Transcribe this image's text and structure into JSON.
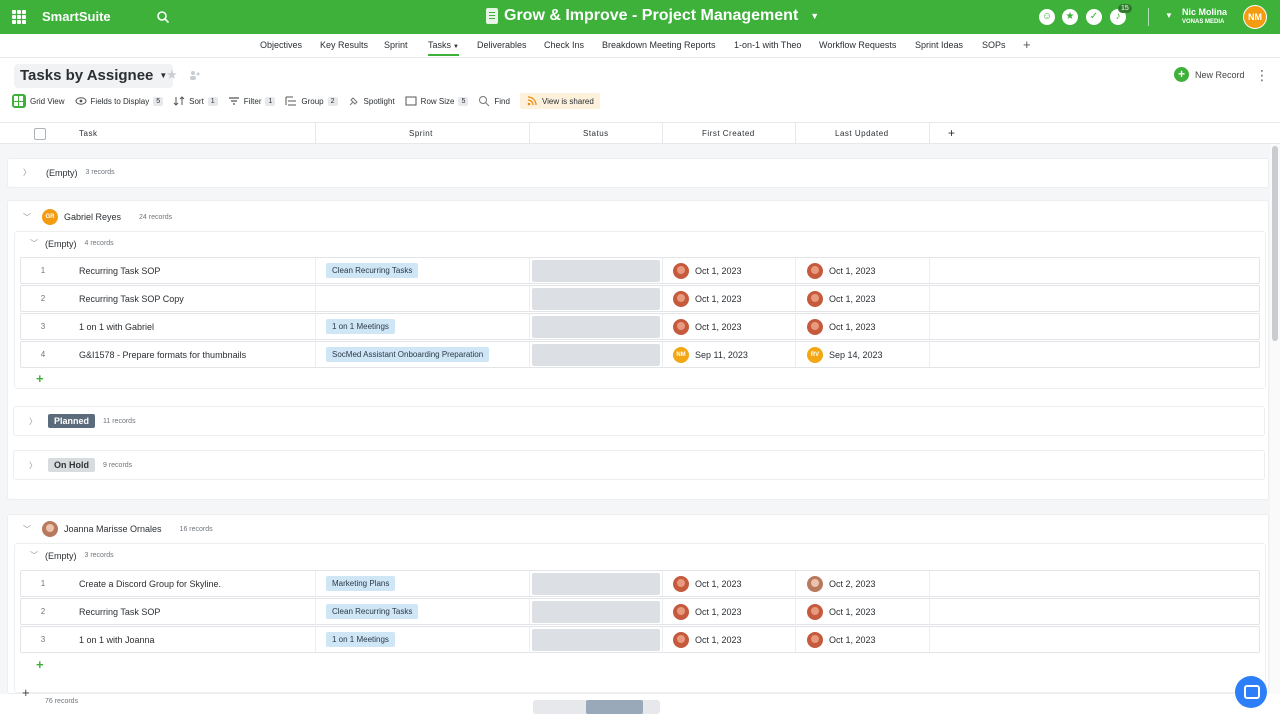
{
  "app": {
    "brand": "SmartSuite",
    "solution_title": "Grow & Improve - Project Management",
    "notifications": "15"
  },
  "user": {
    "name": "Nic Molina",
    "org": "VONAS MEDIA",
    "initials": "NM"
  },
  "tabs": [
    "Objectives",
    "Key Results",
    "Sprint",
    "Tasks",
    "Deliverables",
    "Check Ins",
    "Breakdown Meeting Reports",
    "1-on-1 with Theo",
    "Workflow Requests",
    "Sprint Ideas",
    "SOPs"
  ],
  "view": {
    "title": "Tasks by Assignee",
    "new_record": "New Record"
  },
  "toolbar": {
    "grid_view": "Grid View",
    "fields": "Fields to Display",
    "fields_count": "5",
    "sort": "Sort",
    "sort_count": "1",
    "filter": "Filter",
    "filter_count": "1",
    "group": "Group",
    "group_count": "2",
    "spotlight": "Spotlight",
    "row_size": "Row Size",
    "row_size_count": "5",
    "find": "Find",
    "shared": "View is shared"
  },
  "columns": {
    "task": "Task",
    "sprint": "Sprint",
    "status": "Status",
    "first_created": "First Created",
    "last_updated": "Last Updated"
  },
  "groups": {
    "empty": {
      "label": "(Empty)",
      "count": "3 records"
    },
    "gabriel": {
      "name": "Gabriel Reyes",
      "initials": "GR",
      "count": "24 records",
      "sub_empty": {
        "label": "(Empty)",
        "count": "4 records"
      },
      "rows": [
        {
          "num": "1",
          "task": "Recurring Task SOP",
          "sprint": "Clean Recurring Tasks",
          "first": "Oct 1, 2023",
          "last": "Oct 1, 2023"
        },
        {
          "num": "2",
          "task": "Recurring Task SOP Copy",
          "sprint": "",
          "first": "Oct 1, 2023",
          "last": "Oct 1, 2023"
        },
        {
          "num": "3",
          "task": "1 on 1 with Gabriel",
          "sprint": "1 on 1 Meetings",
          "first": "Oct 1, 2023",
          "last": "Oct 1, 2023"
        },
        {
          "num": "4",
          "task": "G&I1578 - Prepare formats for thumbnails",
          "sprint": "SocMed Assistant Onboarding Preparation",
          "first": "Sep 11, 2023",
          "last": "Sep 14, 2023",
          "first_initials": "NM",
          "last_initials": "RV"
        }
      ],
      "planned": {
        "label": "Planned",
        "count": "11 records"
      },
      "onhold": {
        "label": "On Hold",
        "count": "9 records"
      }
    },
    "joanna": {
      "name": "Joanna Marisse Ornales",
      "count": "16 records",
      "sub_empty": {
        "label": "(Empty)",
        "count": "3 records"
      },
      "rows": [
        {
          "num": "1",
          "task": "Create a Discord Group for Skyline.",
          "sprint": "Marketing Plans",
          "first": "Oct 1, 2023",
          "last": "Oct 2, 2023"
        },
        {
          "num": "2",
          "task": "Recurring Task SOP",
          "sprint": "Clean Recurring Tasks",
          "first": "Oct 1, 2023",
          "last": "Oct 1, 2023"
        },
        {
          "num": "3",
          "task": "1 on 1 with Joanna",
          "sprint": "1 on 1 Meetings",
          "first": "Oct 1, 2023",
          "last": "Oct 1, 2023"
        }
      ]
    }
  },
  "footer": {
    "total": "76 records"
  },
  "colors": {
    "brand_green": "#3db13a",
    "planned": "#5b6b7b",
    "onhold": "#9ea4aa",
    "tag_bg": "#cfe6f7"
  }
}
